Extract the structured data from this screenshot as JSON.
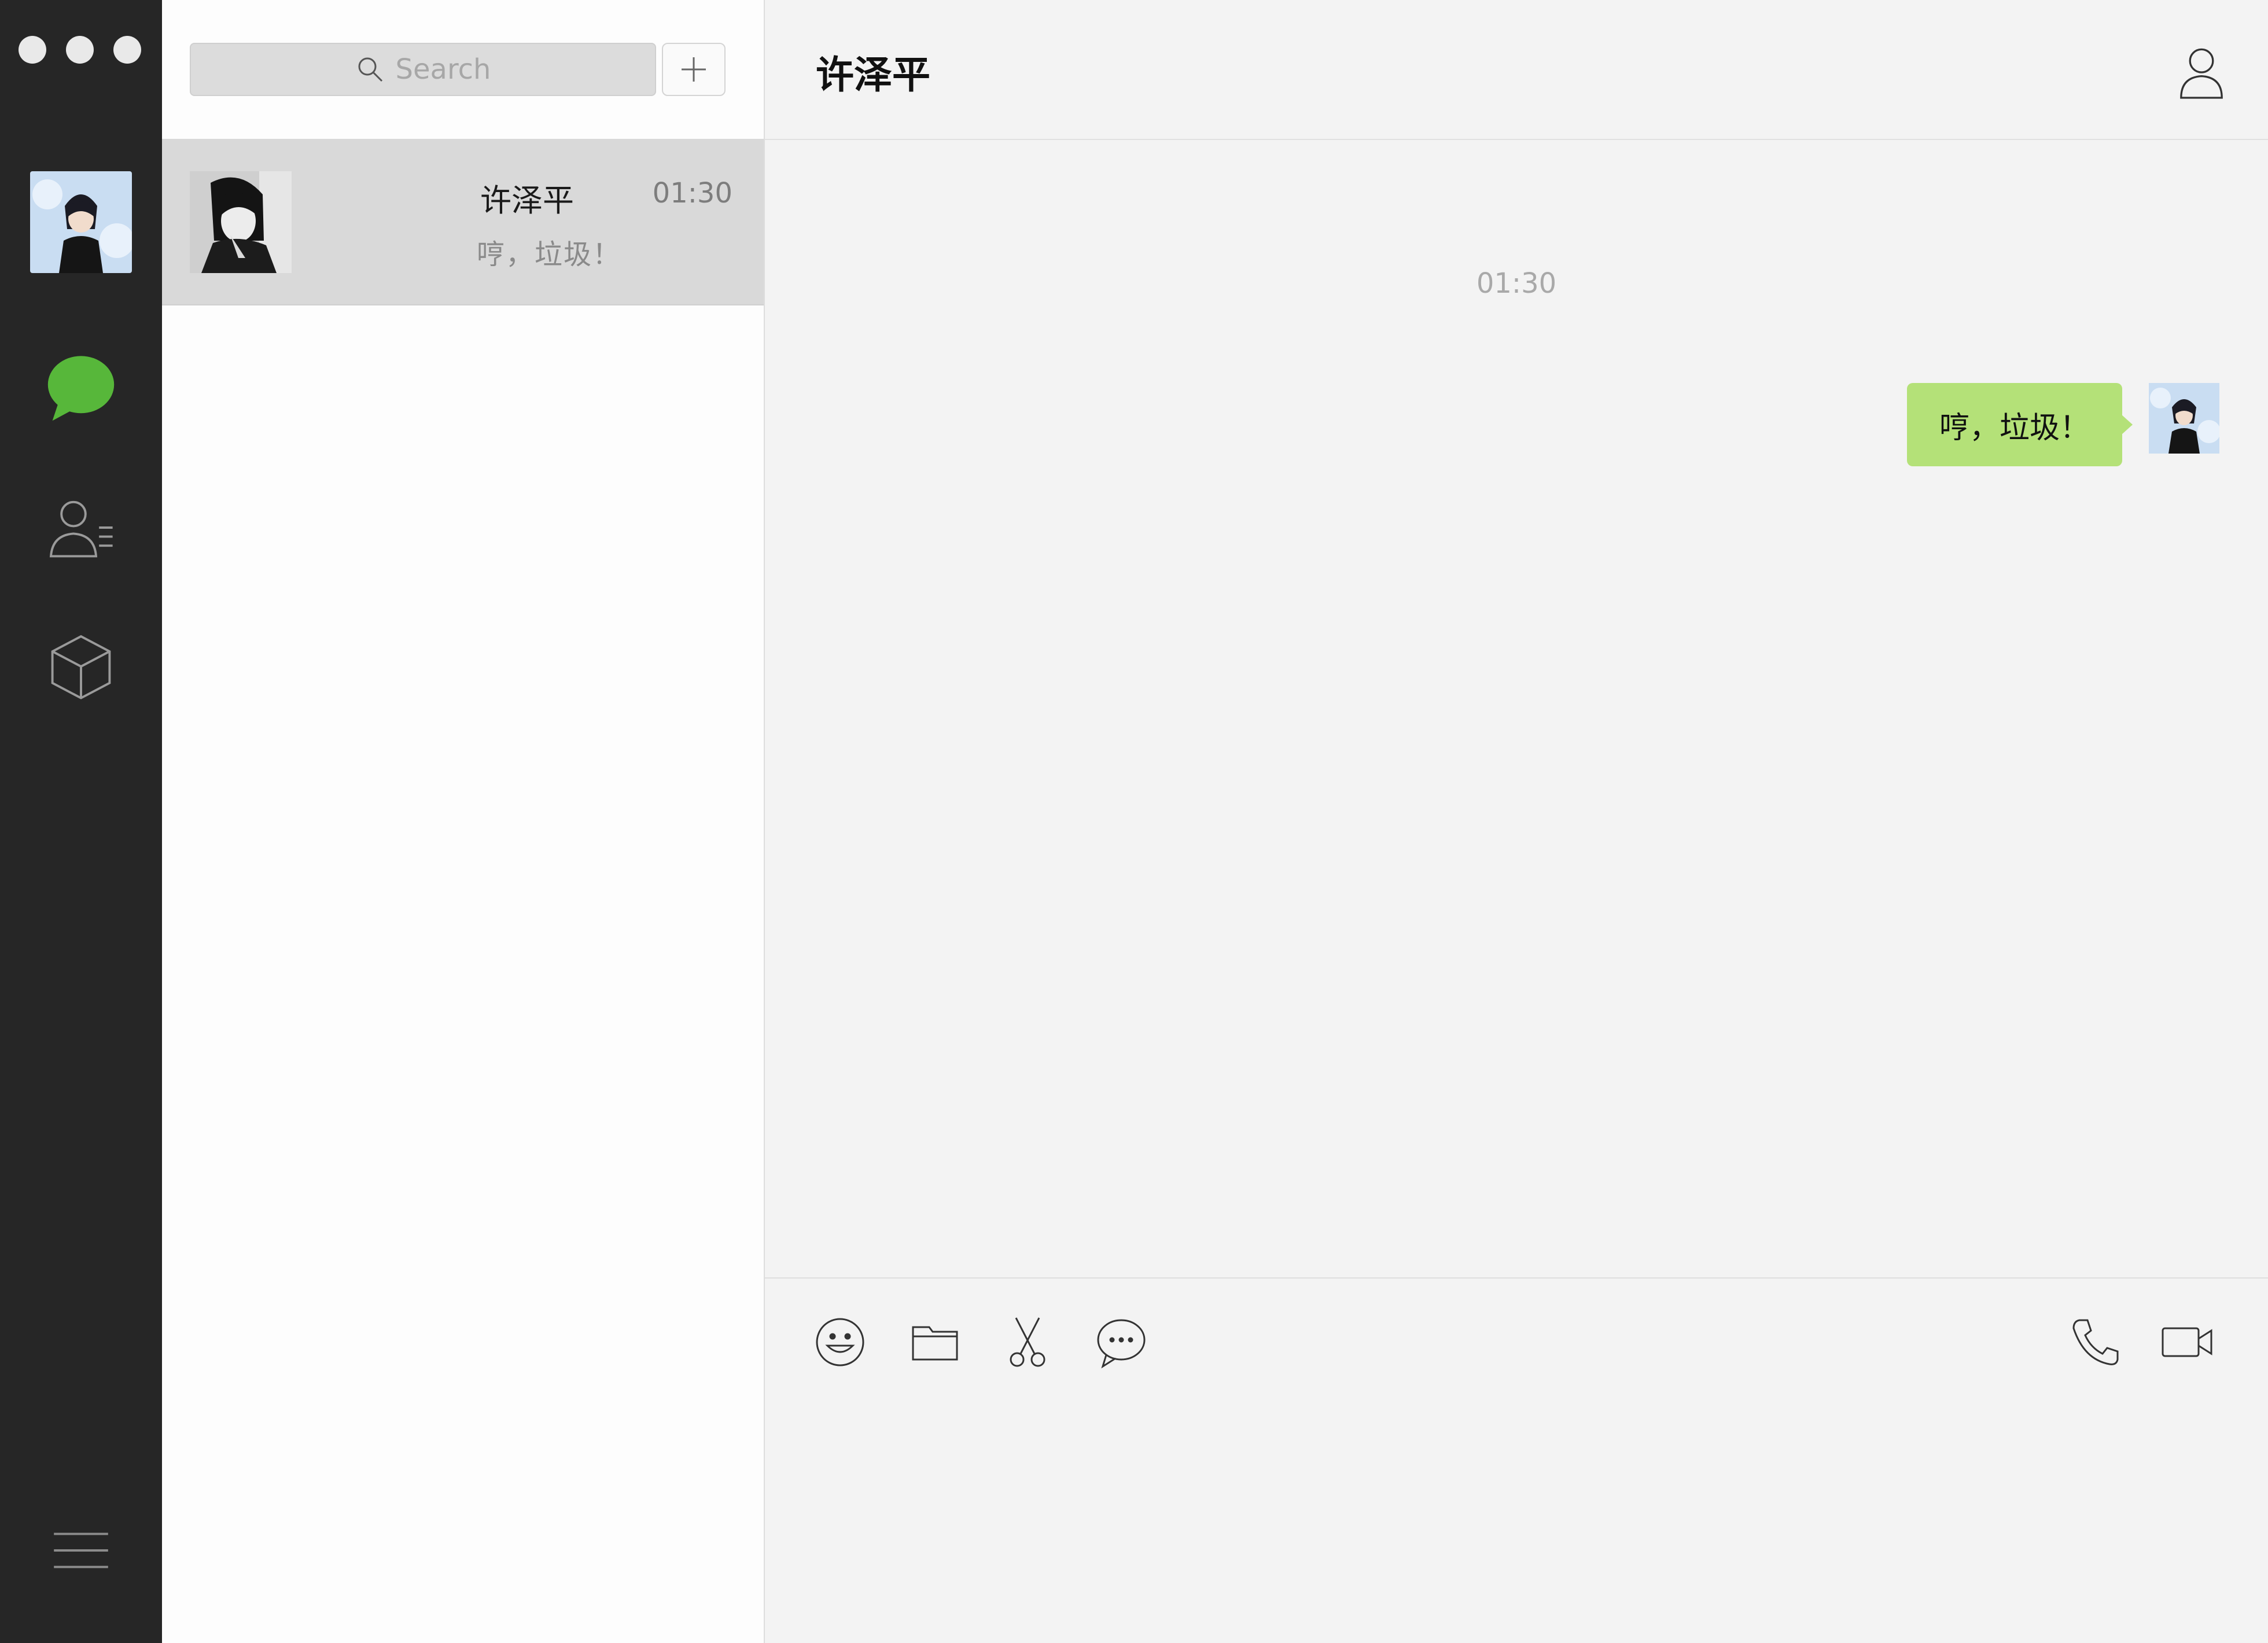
{
  "sidebar": {
    "icons": [
      "chat-icon",
      "contacts-icon",
      "collections-icon",
      "menu-icon"
    ],
    "chat_icon_color": "#57b73a"
  },
  "search": {
    "placeholder": "Search"
  },
  "conversations": [
    {
      "name": "许泽平",
      "time": "01:30",
      "preview": "哼，垃圾！"
    }
  ],
  "chat": {
    "title": "许泽平",
    "messages": [
      {
        "timestamp": "01:30",
        "text": "哼，垃圾！",
        "bubble_color": "#b4e178",
        "outgoing": true
      }
    ]
  },
  "toolbar": {
    "tools": [
      "emoji-icon",
      "folder-icon",
      "scissors-icon",
      "chat-history-icon",
      "phone-icon",
      "video-icon"
    ]
  }
}
